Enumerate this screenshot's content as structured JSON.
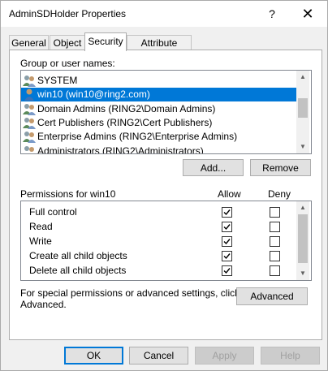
{
  "window": {
    "title": "AdminSDHolder Properties",
    "help_glyph": "?",
    "close_glyph": "✕"
  },
  "tabs": [
    {
      "label": "General",
      "active": false
    },
    {
      "label": "Object",
      "active": false
    },
    {
      "label": "Security",
      "active": true
    },
    {
      "label": "Attribute Editor",
      "active": false
    }
  ],
  "security": {
    "group_label": "Group or user names:",
    "principals": [
      {
        "name": "SYSTEM",
        "icon": "group-icon",
        "selected": false
      },
      {
        "name": "win10 (win10@ring2.com)",
        "icon": "user-icon",
        "selected": true
      },
      {
        "name": "Domain Admins (RING2\\Domain Admins)",
        "icon": "group-icon",
        "selected": false
      },
      {
        "name": "Cert Publishers (RING2\\Cert Publishers)",
        "icon": "group-icon",
        "selected": false
      },
      {
        "name": "Enterprise Admins (RING2\\Enterprise Admins)",
        "icon": "group-icon",
        "selected": false
      },
      {
        "name": "Administrators (RING2\\Administrators)",
        "icon": "group-icon",
        "selected": false
      }
    ],
    "add_label": "Add...",
    "remove_label": "Remove",
    "permissions_label": "Permissions for win10",
    "allow_label": "Allow",
    "deny_label": "Deny",
    "permissions": [
      {
        "name": "Full control",
        "allow": true,
        "deny": false
      },
      {
        "name": "Read",
        "allow": true,
        "deny": false
      },
      {
        "name": "Write",
        "allow": true,
        "deny": false
      },
      {
        "name": "Create all child objects",
        "allow": true,
        "deny": false
      },
      {
        "name": "Delete all child objects",
        "allow": true,
        "deny": false
      }
    ],
    "special_text_line1": "For special permissions or advanced settings, click",
    "special_text_line2": "Advanced.",
    "advanced_label": "Advanced"
  },
  "footer": {
    "ok_label": "OK",
    "cancel_label": "Cancel",
    "apply_label": "Apply",
    "help_label": "Help"
  },
  "colors": {
    "selection": "#0078d7",
    "dialog_bg": "#f0f0f0"
  }
}
